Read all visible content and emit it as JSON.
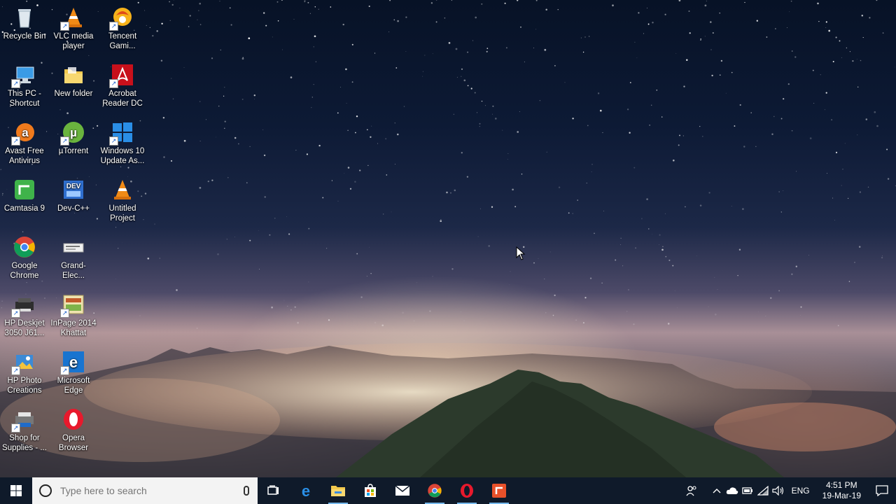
{
  "desktop": {
    "icons": [
      {
        "label": "Recycle Bin",
        "icon": "recycle-bin-icon"
      },
      {
        "label": "VLC media player",
        "icon": "vlc-icon"
      },
      {
        "label": "Tencent Gami...",
        "icon": "tencent-gaming-icon"
      },
      {
        "label": "This PC - Shortcut",
        "icon": "this-pc-icon"
      },
      {
        "label": "New folder",
        "icon": "folder-icon"
      },
      {
        "label": "Acrobat Reader DC",
        "icon": "acrobat-icon"
      },
      {
        "label": "Avast Free Antivirus",
        "icon": "avast-icon"
      },
      {
        "label": "µTorrent",
        "icon": "utorrent-icon"
      },
      {
        "label": "Windows 10 Update As...",
        "icon": "windows-update-icon"
      },
      {
        "label": "Camtasia 9",
        "icon": "camtasia-icon"
      },
      {
        "label": "Dev-C++",
        "icon": "devcpp-icon"
      },
      {
        "label": "Untitled Project",
        "icon": "vlc-project-icon"
      },
      {
        "label": "Google Chrome",
        "icon": "chrome-icon"
      },
      {
        "label": "Grand-Elec...",
        "icon": "document-icon"
      },
      {
        "label": "HP Deskjet 3050 J61...",
        "icon": "printer-icon"
      },
      {
        "label": "InPage 2014 Khattat",
        "icon": "inpage-icon"
      },
      {
        "label": "HP Photo Creations",
        "icon": "hp-photo-icon"
      },
      {
        "label": "Microsoft Edge",
        "icon": "edge-icon"
      },
      {
        "label": "Shop for Supplies - ...",
        "icon": "shop-supplies-icon"
      },
      {
        "label": "Opera Browser",
        "icon": "opera-icon"
      }
    ]
  },
  "taskbar": {
    "search_placeholder": "Type here to search",
    "pinned": [
      "task-view-icon",
      "edge-icon",
      "file-explorer-icon",
      "store-icon",
      "mail-icon",
      "chrome-icon",
      "opera-icon",
      "camtasia-icon"
    ],
    "tray": {
      "language": "ENG",
      "time": "4:51 PM",
      "date": "19-Mar-19"
    }
  },
  "colors": {
    "taskbar_bg": "#0f1a2a",
    "search_bg": "#f3f3f3",
    "accent": "#76b9ed"
  }
}
